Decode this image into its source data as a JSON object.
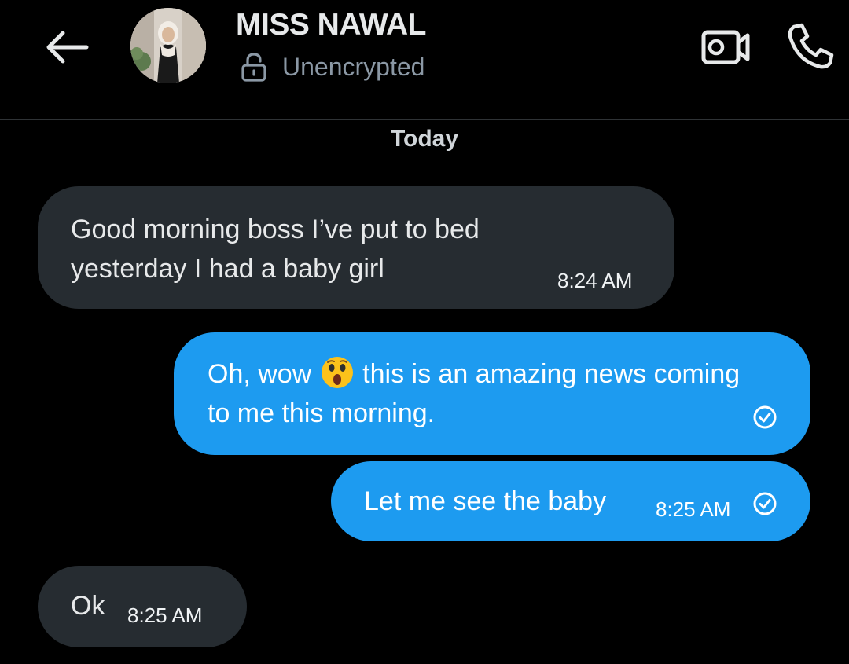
{
  "header": {
    "contact_name": "MISS NAWAL",
    "status": "Unencrypted"
  },
  "conversation": {
    "day_label": "Today",
    "messages": [
      {
        "direction": "incoming",
        "text": "Good morning boss I’ve put to bed yesterday I had a baby girl",
        "time": "8:24 AM"
      },
      {
        "direction": "outgoing",
        "text_before_emoji": "Oh, wow ",
        "emoji": "astonished-face",
        "text_after_emoji": " this is an amazing news coming to me this morning.",
        "status_icon": "check-circle-icon"
      },
      {
        "direction": "outgoing",
        "text": "Let me see the baby",
        "time": "8:25 AM",
        "status_icon": "check-circle-icon"
      },
      {
        "direction": "incoming",
        "text": "Ok",
        "time": "8:25 AM"
      }
    ]
  },
  "colors": {
    "background": "#000000",
    "incoming_bubble": "#262c31",
    "outgoing_bubble": "#1d9bf0",
    "secondary_text": "#8b98a5"
  }
}
